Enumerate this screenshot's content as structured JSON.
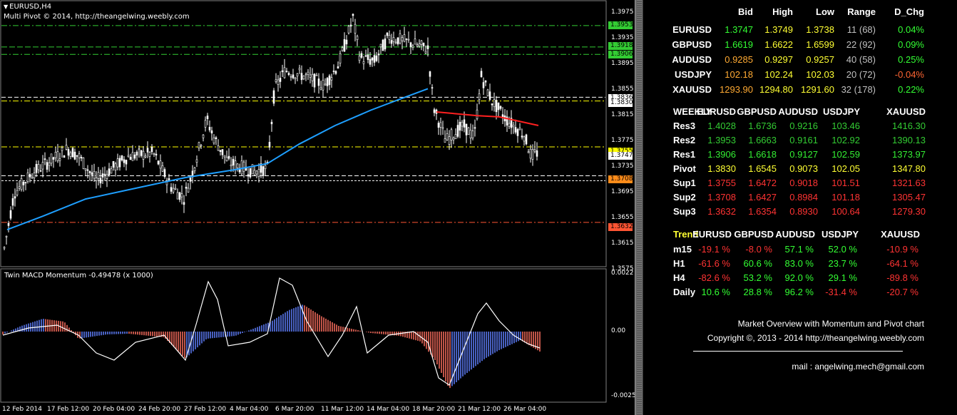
{
  "chart": {
    "symbol_title": "EURUSD,H4",
    "indicator_title": "Multi Pivot © 2014, http://theangelwing.weebly.com",
    "sub_title": "Twin MACD Momentum -0.49478 (x 1000)",
    "price_labels": [
      "1.3975",
      "1.3935",
      "1.3895",
      "1.3855",
      "1.3815",
      "1.3775",
      "1.3735",
      "1.3695",
      "1.3655",
      "1.3615",
      "1.3575"
    ],
    "axis_tags": [
      {
        "text": "1.3953",
        "color": "#33cc33"
      },
      {
        "text": "1.3918",
        "color": "#33cc33"
      },
      {
        "text": "1.3906",
        "color": "#33cc33"
      },
      {
        "text": "1.3836",
        "color": "#ffffff"
      },
      {
        "text": "1.3830",
        "color": "#ffffff"
      },
      {
        "text": "1.3755",
        "color": "#ffff00"
      },
      {
        "text": "1.3747",
        "color": "#ffffff"
      },
      {
        "text": "1.3708",
        "color": "#ff8c1a"
      },
      {
        "text": "1.3632",
        "color": "#ff5533"
      }
    ],
    "macd_labels": [
      "0.0022",
      "0.00",
      "-0.0025"
    ],
    "time_labels": [
      "12 Feb 2014",
      "17 Feb 12:00",
      "20 Feb 04:00",
      "24 Feb 20:00",
      "27 Feb 12:00",
      "4 Mar 04:00",
      "6 Mar 20:00",
      "11 Mar 12:00",
      "14 Mar 04:00",
      "18 Mar 20:00",
      "21 Mar 12:00",
      "26 Mar 04:00"
    ],
    "colors": {
      "candle": "#ffffff",
      "ma_line": "#1e9fff",
      "trend_line": "#ff2020",
      "green_line": "#33cc33",
      "yellow_line": "#ffff00",
      "white_line": "#ffffff",
      "orange_line": "#ff8c1a",
      "red_line": "#ff5533",
      "hist_positive": "#6080ff",
      "hist_negative": "#ff7060"
    }
  },
  "panel": {
    "header": [
      "Bid",
      "High",
      "Low",
      "Range",
      "D_Chg"
    ],
    "quotes": [
      {
        "symbol": "EURUSD",
        "bid": "1.3747",
        "high": "1.3749",
        "low": "1.3738",
        "range": "11 (68)",
        "chg": "0.04%",
        "color": "#33ff33"
      },
      {
        "symbol": "GBPUSD",
        "bid": "1.6619",
        "high": "1.6622",
        "low": "1.6599",
        "range": "22 (92)",
        "chg": "0.09%",
        "color": "#33ff33"
      },
      {
        "symbol": "AUDUSD",
        "bid": "0.9285",
        "high": "0.9297",
        "low": "0.9257",
        "range": "40 (58)",
        "chg": "0.25%",
        "color": "#ffaa33"
      },
      {
        "symbol": "USDJPY",
        "bid": "102.18",
        "high": "102.24",
        "low": "102.03",
        "range": "20 (72)",
        "chg": "-0.04%",
        "color": "#ffaa33"
      },
      {
        "symbol": "XAUUSD",
        "bid": "1293.90",
        "high": "1294.80",
        "low": "1291.60",
        "range": "32 (178)",
        "chg": "0.22%",
        "color": "#ffaa33"
      }
    ],
    "weekly_header": [
      "WEEKLY",
      "EURUSD",
      "GBPUSD",
      "AUDUSD",
      "USDJPY",
      "XAUUSD"
    ],
    "weekly": [
      {
        "label": "Res3",
        "values": [
          "1.4028",
          "1.6736",
          "0.9216",
          "103.46",
          "1416.30"
        ],
        "color": "#33cc33"
      },
      {
        "label": "Res2",
        "values": [
          "1.3953",
          "1.6663",
          "0.9161",
          "102.92",
          "1390.13"
        ],
        "color": "#33cc33"
      },
      {
        "label": "Res1",
        "values": [
          "1.3906",
          "1.6618",
          "0.9127",
          "102.59",
          "1373.97"
        ],
        "color": "#33ee33"
      },
      {
        "label": "Pivot",
        "values": [
          "1.3830",
          "1.6545",
          "0.9073",
          "102.05",
          "1347.80"
        ],
        "color": "#ffff33"
      },
      {
        "label": "Sup1",
        "values": [
          "1.3755",
          "1.6472",
          "0.9018",
          "101.51",
          "1321.63"
        ],
        "color": "#ff3333"
      },
      {
        "label": "Sup2",
        "values": [
          "1.3708",
          "1.6427",
          "0.8984",
          "101.18",
          "1305.47"
        ],
        "color": "#ff3333"
      },
      {
        "label": "Sup3",
        "values": [
          "1.3632",
          "1.6354",
          "0.8930",
          "100.64",
          "1279.30"
        ],
        "color": "#ff3333"
      }
    ],
    "trend_header": [
      "Trend",
      "EURUSD",
      "GBPUSD",
      "AUDUSD",
      "USDJPY",
      "XAUUSD"
    ],
    "trend": [
      {
        "label": "m15",
        "values": [
          {
            "v": "-19.1 %",
            "c": "#ff3333"
          },
          {
            "v": "-8.0 %",
            "c": "#ff3333"
          },
          {
            "v": "57.1 %",
            "c": "#33ff33"
          },
          {
            "v": "52.0 %",
            "c": "#33ff33"
          },
          {
            "v": "-10.9 %",
            "c": "#ff3333"
          }
        ]
      },
      {
        "label": "H1",
        "values": [
          {
            "v": "-61.6 %",
            "c": "#ff3333"
          },
          {
            "v": "60.6 %",
            "c": "#33ff33"
          },
          {
            "v": "83.0 %",
            "c": "#33ff33"
          },
          {
            "v": "23.7 %",
            "c": "#33ff33"
          },
          {
            "v": "-64.1 %",
            "c": "#ff3333"
          }
        ]
      },
      {
        "label": "H4",
        "values": [
          {
            "v": "-82.6 %",
            "c": "#ff3333"
          },
          {
            "v": "53.2 %",
            "c": "#33ff33"
          },
          {
            "v": "92.0 %",
            "c": "#33ff33"
          },
          {
            "v": "29.1 %",
            "c": "#33ff33"
          },
          {
            "v": "-89.8 %",
            "c": "#ff3333"
          }
        ]
      },
      {
        "label": "Daily",
        "values": [
          {
            "v": "10.6 %",
            "c": "#33ff33"
          },
          {
            "v": "28.8 %",
            "c": "#33ff33"
          },
          {
            "v": "96.2 %",
            "c": "#33ff33"
          },
          {
            "v": "-31.4 %",
            "c": "#ff3333"
          },
          {
            "v": "-20.7 %",
            "c": "#ff3333"
          }
        ]
      }
    ],
    "footer": {
      "line1": "Market Overview with Momentum and Pivot chart",
      "line2": "Copyright ©, 2013 - 2014 http://theangelwing.weebly.com",
      "mail": "mail : angelwing.mech@gmail.com"
    }
  }
}
